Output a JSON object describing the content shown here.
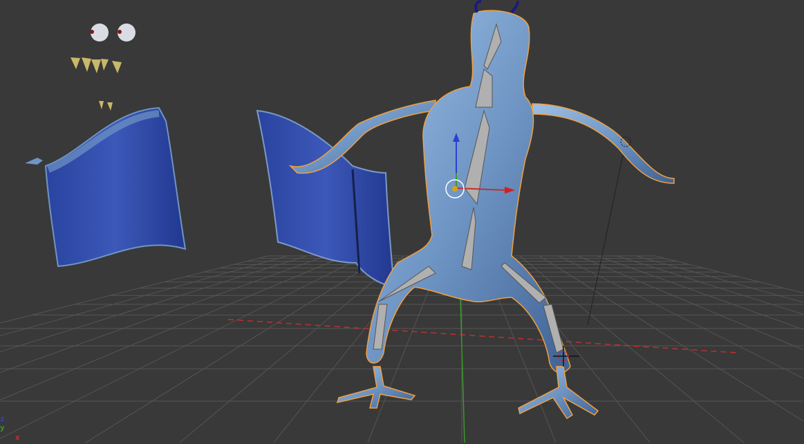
{
  "viewport": {
    "axis_labels": {
      "z": "z",
      "y": "y",
      "x": "x"
    },
    "colors": {
      "background": "#393939",
      "grid": "#555555",
      "x_axis": "#c0302f",
      "y_axis": "#3a9a2a",
      "z_axis": "#2e3fd0",
      "mesh": "#6f95c4",
      "selection_outline": "#f0a040",
      "cloth": "#2b46a8",
      "bone": "#a8a8a8"
    }
  }
}
